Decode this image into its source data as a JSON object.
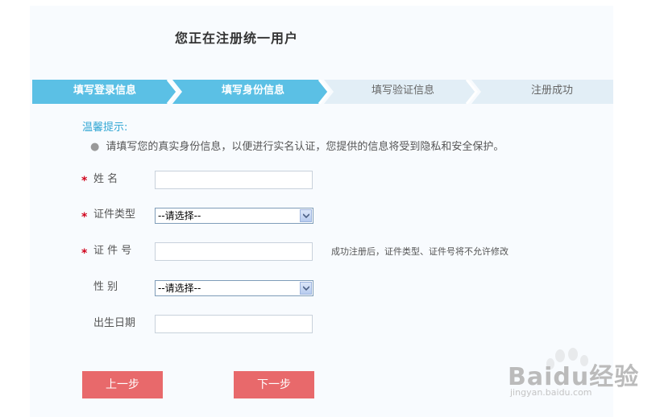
{
  "page": {
    "title": "您正在注册统一用户"
  },
  "steps": [
    {
      "label": "填写登录信息",
      "state": "done"
    },
    {
      "label": "填写身份信息",
      "state": "current"
    },
    {
      "label": "填写验证信息",
      "state": "pending"
    },
    {
      "label": "注册成功",
      "state": "pending"
    }
  ],
  "colors": {
    "step_active": "#5bc0e5",
    "step_inactive": "#e2eef6",
    "button": "#e8696b",
    "required": "#d0021b",
    "tip": "#33a7d4"
  },
  "tips": {
    "title": "温馨提示:",
    "text": "请填写您的真实身份信息，以便进行实名认证，您提供的信息将受到隐私和安全保护。"
  },
  "form": {
    "name": {
      "label": "姓 名",
      "required": true,
      "value": ""
    },
    "id_type": {
      "label": "证件类型",
      "required": true,
      "selected": "--请选择--"
    },
    "id_number": {
      "label": "证 件 号",
      "required": true,
      "value": "",
      "hint": "成功注册后，证件类型、证件号将不允许修改"
    },
    "gender": {
      "label": "性 别",
      "required": false,
      "selected": "--请选择--"
    },
    "birthday": {
      "label": "出生日期",
      "required": false,
      "value": ""
    }
  },
  "buttons": {
    "prev": "上一步",
    "next": "下一步"
  },
  "watermark": {
    "brand": "Baidu经验",
    "url": "jingyan.baidu.com"
  }
}
